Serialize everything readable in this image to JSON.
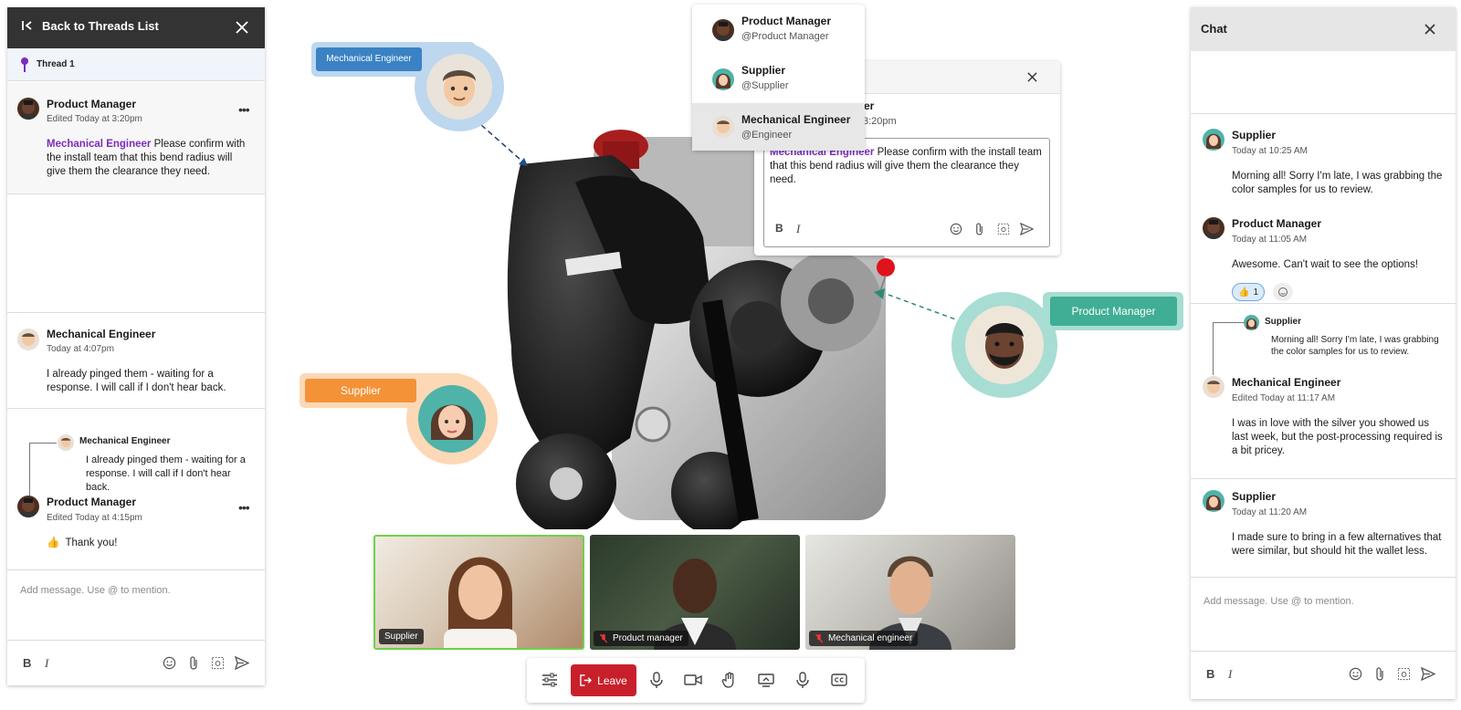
{
  "thread_panel": {
    "back_label": "Back to Threads List",
    "thread_label": "Thread 1",
    "messages": [
      {
        "author": "Product Manager",
        "meta": "Edited Today at 3:20pm",
        "mention": "Mechanical Engineer",
        "text": " Please confirm with the install team that this bend radius will give them the clearance they need."
      },
      {
        "author": "Mechanical Engineer",
        "meta": "Today at 4:07pm",
        "text": "I already pinged them - waiting for a response. I will call if I don't hear back."
      },
      {
        "quote_author": "Mechanical Engineer",
        "quote_text": "I already pinged them - waiting for a response. I will call if I don't hear back.",
        "author": "Product Manager",
        "meta": "Edited Today at 4:15pm",
        "text": "Thank you!"
      }
    ],
    "input_placeholder": "Add message. Use @ to mention."
  },
  "mention_popup": {
    "items": [
      {
        "name": "Product Manager",
        "handle": "@Product Manager"
      },
      {
        "name": "Supplier",
        "handle": "@Supplier"
      },
      {
        "name": "Mechanical Engineer",
        "handle": "@Engineer"
      }
    ]
  },
  "comment_card": {
    "author_partial": "ager",
    "time_partial": "3:20pm",
    "mention": "Mechanical Engineer",
    "text": " Please confirm with the install team that this bend radius will give them the clearance they need."
  },
  "labels": {
    "mechanical_engineer": "Mechanical Engineer",
    "product_manager": "Product Manager",
    "supplier": "Supplier"
  },
  "video_tiles": [
    {
      "label": "Supplier"
    },
    {
      "label": "Product manager"
    },
    {
      "label": "Mechanical engineer"
    }
  ],
  "controls": {
    "leave_label": "Leave"
  },
  "chat_panel": {
    "title": "Chat",
    "messages": [
      {
        "author": "Supplier",
        "meta": "Today at 10:25 AM",
        "text": "Morning all! Sorry I'm late, I was grabbing the color samples for us to review."
      },
      {
        "author": "Product Manager",
        "meta": "Today at 11:05 AM",
        "text": "Awesome. Can't wait to see the options!",
        "reaction_count": "1"
      },
      {
        "quote_author": "Supplier",
        "quote_text": "Morning all! Sorry I'm late, I was grabbing the color samples for us to review.",
        "author": "Mechanical Engineer",
        "meta": "Edited Today at 11:17 AM",
        "text": "I was in love with the silver you showed us last week, but the post-processing required is a bit pricey."
      },
      {
        "author": "Supplier",
        "meta": "Today at 11:20 AM",
        "text": "I made sure to bring in a few alternatives that were similar, but should hit the wallet less."
      }
    ],
    "input_placeholder": "Add message. Use @ to mention."
  },
  "colors": {
    "mention": "#7b2cbf",
    "leave": "#c8202b",
    "me_tag": "#3a82c4",
    "pm_tag": "#3fae94",
    "sup_tag": "#f39237"
  }
}
